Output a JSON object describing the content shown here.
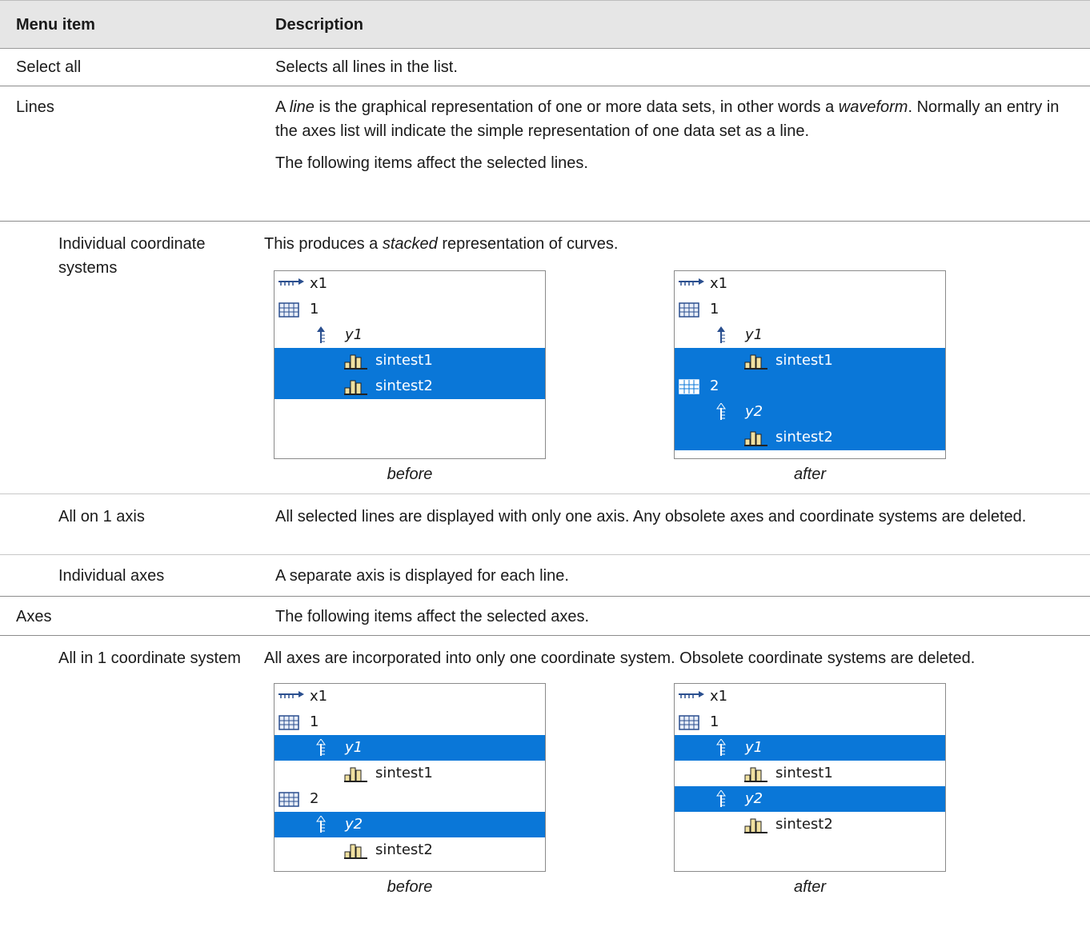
{
  "table": {
    "headers": {
      "menu_item": "Menu item",
      "description": "Description"
    },
    "rows": {
      "select_all": {
        "item": "Select all",
        "desc": "Selects all lines in the list."
      },
      "lines": {
        "item": "Lines",
        "desc_p1_a": "A ",
        "desc_p1_line": "line",
        "desc_p1_b": " is the graphical representation of one or more data sets, in other words a ",
        "desc_p1_waveform": "waveform",
        "desc_p1_c": ". Normally an entry in the axes list will indicate the simple representation of one data set as a line.",
        "desc_p2": "The following items affect the selected lines."
      },
      "individual_cs": {
        "item": "Individual coordinate systems",
        "desc_a": "This produces a ",
        "desc_stacked": "stacked",
        "desc_b": " representation of curves."
      },
      "all_on_1_axis": {
        "item": "All on 1 axis",
        "desc": "All selected lines are displayed with only one axis. Any obsolete axes and coordinate systems are deleted."
      },
      "individual_axes": {
        "item": "Individual axes",
        "desc": "A separate axis is displayed for each line."
      },
      "axes": {
        "item": "Axes",
        "desc": "The following items affect the selected axes."
      },
      "all_in_1_cs": {
        "item": "All in 1 coordinate system",
        "desc": "All axes are incorporated into only one coordinate system. Obsolete coordinate systems are deleted."
      }
    }
  },
  "trees": {
    "caption_before": "before",
    "caption_after": "after",
    "labels": {
      "x1": "x1",
      "cs1": "1",
      "cs2": "2",
      "y1": "y1",
      "y2": "y2",
      "sintest1": "sintest1",
      "sintest2": "sintest2"
    }
  },
  "colors": {
    "selection": "#0a77d8",
    "header_bg": "#e6e6e6"
  }
}
